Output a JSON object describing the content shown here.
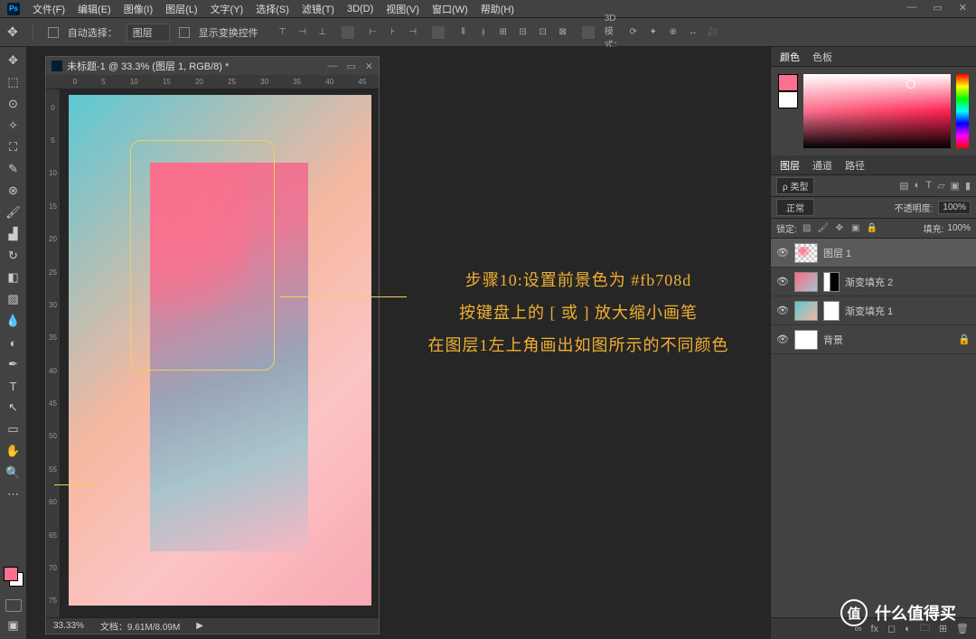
{
  "menubar": {
    "items": [
      "文件(F)",
      "编辑(E)",
      "图像(I)",
      "图层(L)",
      "文字(Y)",
      "选择(S)",
      "滤镜(T)",
      "3D(D)",
      "视图(V)",
      "窗口(W)",
      "帮助(H)"
    ]
  },
  "options": {
    "auto_select": "自动选择：",
    "auto_select_value": "图层",
    "show_transform": "显示变换控件",
    "mode_3d": "3D 模式："
  },
  "document": {
    "title": "未标题-1 @ 33.3% (图层 1, RGB/8) *",
    "ruler_h": [
      "0",
      "5",
      "10",
      "15",
      "20",
      "25",
      "30",
      "35",
      "40",
      "45"
    ],
    "ruler_v": [
      "0",
      "5",
      "10",
      "15",
      "20",
      "25",
      "30",
      "35",
      "40",
      "45",
      "50",
      "55",
      "60",
      "65",
      "70",
      "75"
    ],
    "zoom": "33.33%",
    "file_info": "文档：9.61M/8.09M"
  },
  "annotation": {
    "line1": "步骤10:设置前景色为 #fb708d",
    "line2": "按键盘上的 [ 或 ] 放大缩小画笔",
    "line3": "在图层1左上角画出如图所示的不同颜色"
  },
  "color_panel": {
    "tabs": [
      "颜色",
      "色板"
    ],
    "foreground": "#fb708d"
  },
  "layers_panel": {
    "tabs": [
      "图层",
      "通道",
      "路径"
    ],
    "filter_type": "ρ 类型",
    "blend_mode": "正常",
    "opacity_label": "不透明度:",
    "opacity_value": "100%",
    "lock_label": "锁定:",
    "fill_label": "填充:",
    "fill_value": "100%",
    "layers": [
      {
        "name": "图层 1",
        "type": "checker"
      },
      {
        "name": "渐变填充 2",
        "type": "grad2",
        "mask": true
      },
      {
        "name": "渐变填充 1",
        "type": "grad1",
        "mask": true
      },
      {
        "name": "背景",
        "type": "white",
        "locked": true
      }
    ]
  },
  "watermark": "什么值得买"
}
